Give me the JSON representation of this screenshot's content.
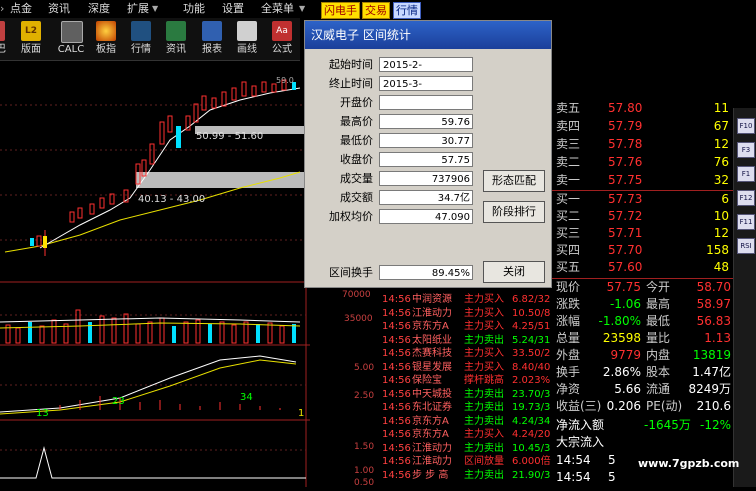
{
  "menu": {
    "items": [
      "点金",
      "资讯",
      "深度",
      "扩展",
      "功能",
      "设置",
      "全菜单"
    ],
    "highlight_buttons": [
      "闪电手",
      "交易",
      "行情"
    ]
  },
  "toolbar": {
    "items": [
      "版面",
      "CALC",
      "板指",
      "行情",
      "资讯",
      "报表",
      "画线",
      "公式"
    ],
    "partial_left": "巴"
  },
  "chart": {
    "annotations": {
      "range_upper": "50.99 - 51.60",
      "range_lower": "40.13 - 43.00",
      "peak_label": "59.0"
    },
    "volume_axis": [
      "70000",
      "35000"
    ],
    "macd_axis": [
      "5.00",
      "2.50"
    ],
    "macd_numbers": [
      "13",
      "23",
      "34",
      "1"
    ],
    "bottom_axis": [
      "1.50",
      "1.00",
      "0.50"
    ]
  },
  "dialog": {
    "title": "汉威电子  区间统计",
    "fields": [
      {
        "label": "起始时间",
        "value": "2015-2-"
      },
      {
        "label": "终止时间",
        "value": "2015-3-"
      },
      {
        "label": "开盘价",
        "value": ""
      },
      {
        "label": "最高价",
        "value": "59.76"
      },
      {
        "label": "最低价",
        "value": "30.77"
      },
      {
        "label": "收盘价",
        "value": "57.75"
      },
      {
        "label": "成交量",
        "value": "737906"
      },
      {
        "label": "成交额",
        "value": "34.7亿"
      },
      {
        "label": "加权均价",
        "value": "47.090"
      }
    ],
    "turnover": {
      "label": "区间换手",
      "value": "89.45%"
    },
    "buttons": {
      "pattern": "形态匹配",
      "rank": "阶段排行",
      "close": "关闭"
    }
  },
  "orderbook": {
    "sells": [
      {
        "label": "卖四",
        "price": "57.79",
        "vol": "67"
      },
      {
        "label": "卖三",
        "price": "57.78",
        "vol": "12"
      },
      {
        "label": "卖二",
        "price": "57.76",
        "vol": "76"
      },
      {
        "label": "卖一",
        "price": "57.75",
        "vol": "32"
      }
    ],
    "buys": [
      {
        "label": "买一",
        "price": "57.73",
        "vol": "6"
      },
      {
        "label": "买二",
        "price": "57.72",
        "vol": "10"
      },
      {
        "label": "买三",
        "price": "57.71",
        "vol": "12"
      },
      {
        "label": "买四",
        "price": "57.70",
        "vol": "158"
      },
      {
        "label": "买五",
        "price": "57.60",
        "vol": "48"
      }
    ],
    "top_partial": {
      "label": "卖五",
      "price": "57.80",
      "vol": "11"
    }
  },
  "quote": {
    "rows": [
      {
        "l1": "现价",
        "v1": "57.75",
        "l2": "今开",
        "v2": "58.70"
      },
      {
        "l1": "涨跌",
        "v1": "-1.06",
        "l2": "最高",
        "v2": "58.97"
      },
      {
        "l1": "涨幅",
        "v1": "-1.80%",
        "l2": "最低",
        "v2": "56.83"
      },
      {
        "l1": "总量",
        "v1": "23598",
        "l2": "量比",
        "v2": "1.13"
      },
      {
        "l1": "外盘",
        "v1": "9779",
        "l2": "内盘",
        "v2": "13819"
      },
      {
        "l1": "换手",
        "v1": "2.86%",
        "l2": "股本",
        "v2": "1.47亿"
      },
      {
        "l1": "净资",
        "v1": "5.66",
        "l2": "流通",
        "v2": "8249万"
      },
      {
        "l1": "收益(三)",
        "v1": "0.206",
        "l2": "PE(动)",
        "v2": "210.6"
      }
    ],
    "netflow": {
      "label": "净流入额",
      "value": "-1645万",
      "pct": "-12%"
    },
    "bigflow": {
      "label": "大宗流入"
    },
    "times": [
      {
        "t": "14:54",
        "v": "5"
      },
      {
        "t": "14:54",
        "v": "5"
      }
    ]
  },
  "trades": [
    {
      "t": "14:56",
      "name": "中润资源",
      "type": "主力买入",
      "val": "6.82/32"
    },
    {
      "t": "14:56",
      "name": "江淮动力",
      "type": "主力买入",
      "val": "10.50/8"
    },
    {
      "t": "14:56",
      "name": "京东方A",
      "type": "主力买入",
      "val": "4.25/51"
    },
    {
      "t": "14:56",
      "name": "太阳纸业",
      "type": "主力卖出",
      "val": "5.24/31"
    },
    {
      "t": "14:56",
      "name": "杰赛科技",
      "type": "主力买入",
      "val": "33.50/2"
    },
    {
      "t": "14:56",
      "name": "银星发展",
      "type": "主力买入",
      "val": "8.40/40"
    },
    {
      "t": "14:56",
      "name": "保险宝",
      "type": "撑杆跳高",
      "val": "2.023%"
    },
    {
      "t": "14:56",
      "name": "中天城投",
      "type": "主力卖出",
      "val": "23.70/3"
    },
    {
      "t": "14:56",
      "name": "东北证券",
      "type": "主力卖出",
      "val": "19.73/3"
    },
    {
      "t": "14:56",
      "name": "京东方A",
      "type": "主力卖出",
      "val": "4.24/34"
    },
    {
      "t": "14:56",
      "name": "京东方A",
      "type": "主力买入",
      "val": "4.24/20"
    },
    {
      "t": "14:56",
      "name": "江淮动力",
      "type": "主力卖出",
      "val": "10.45/3"
    },
    {
      "t": "14:56",
      "name": "江淮动力",
      "type": "区间放量",
      "val": "6.000倍"
    },
    {
      "t": "14:56",
      "name": "步 步 高",
      "type": "主力卖出",
      "val": "21.90/3"
    }
  ],
  "rightbar_icons": [
    "F10",
    "F3",
    "F1",
    "F12",
    "F11",
    "RSI"
  ],
  "watermark": "www.7gpzb.com",
  "colors": {
    "up": "#ff3030",
    "down": "#00e0ff",
    "ma5": "#ffffff",
    "ma10": "#ffff00",
    "name": "#ff6060",
    "time": "#ff4040",
    "sell_type": "#00ff00",
    "buy_type": "#ff3030"
  }
}
